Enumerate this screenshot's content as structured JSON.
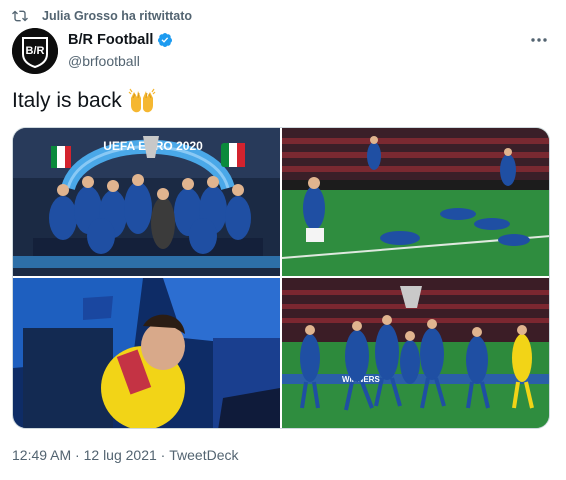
{
  "retweet": {
    "icon": "retweet-icon",
    "text": "Julia Grosso ha ritwittato"
  },
  "author": {
    "name": "B/R Football",
    "handle": "@brfootball",
    "avatar_text": "B/R",
    "verified_icon": "verified-badge-icon",
    "brand_color": "#1d9bf0"
  },
  "tweet": {
    "text": "Italy is back",
    "emoji": "raising-hands-emoji"
  },
  "media": {
    "photos": [
      {
        "name": "trophy-celebration-photo",
        "banner": "UEFA EURO 2020"
      },
      {
        "name": "pitch-slide-celebration-photo"
      },
      {
        "name": "team-huddle-photo"
      },
      {
        "name": "trophy-lift-pitch-photo",
        "board": "WINNERS"
      }
    ]
  },
  "meta": {
    "time": "12:49 AM",
    "separator": " · ",
    "date": "12 lug 2021",
    "source": "TweetDeck"
  }
}
